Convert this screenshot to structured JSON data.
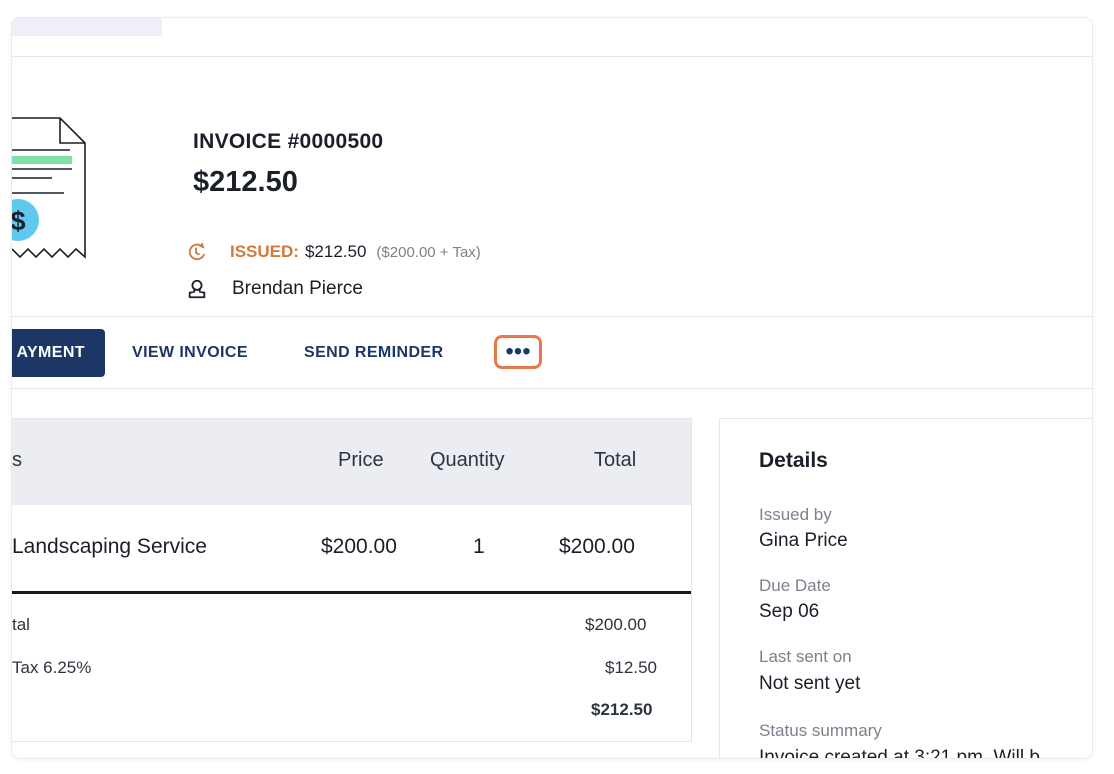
{
  "invoice": {
    "number": "INVOICE #0000500",
    "amount": "$212.50",
    "status_label": "ISSUED:",
    "status_amount": "$212.50",
    "status_breakdown": "($200.00 + Tax)",
    "customer_name": "Brendan Pierce"
  },
  "actions": {
    "primary": "AYMENT",
    "view_invoice": "VIEW INVOICE",
    "send_reminder": "SEND REMINDER",
    "more": "•••"
  },
  "items_table": {
    "headers": [
      "s",
      "Price",
      "Quantity",
      "Total"
    ],
    "rows": [
      {
        "name": "Landscaping Service",
        "price": "$200.00",
        "quantity": "1",
        "total": "$200.00"
      }
    ],
    "summary": [
      {
        "label": "tal",
        "value": "$200.00"
      },
      {
        "label": "Tax 6.25%",
        "value": "$12.50"
      },
      {
        "label": "",
        "value": "$212.50"
      }
    ]
  },
  "details": {
    "title": "Details",
    "fields": [
      {
        "label": "Issued by",
        "value": "Gina Price"
      },
      {
        "label": "Due Date",
        "value": "Sep 06"
      },
      {
        "label": "Last sent on",
        "value": "Not sent yet"
      },
      {
        "label": "Status summary",
        "value": "Invoice created at 3:21 pm. Will b"
      }
    ]
  },
  "colors": {
    "primary": "#1c3766",
    "status_issued": "#d17a3b",
    "highlight_border": "#e8774a",
    "illustration_green": "#7fe0a8",
    "illustration_blue": "#5fc8ee"
  },
  "icons": [
    "invoice-illustration",
    "clock-icon",
    "person-icon",
    "more-dots-icon"
  ]
}
